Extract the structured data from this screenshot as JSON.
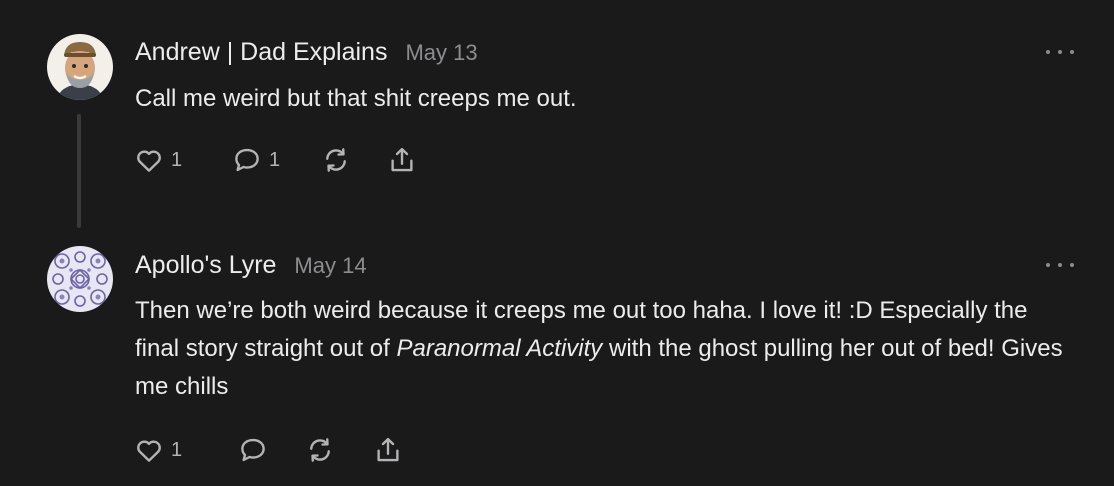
{
  "comments": [
    {
      "author": "Andrew | Dad Explains",
      "date": "May 13",
      "text": "Call me weird but that shit creeps me out.",
      "likes": "1",
      "replies": "1",
      "avatar_icon": "cartoon-man-portrait"
    },
    {
      "author": "Apollo's Lyre",
      "date": "May 14",
      "text_before": "Then we’re both weird because it creeps me out too haha. I love it! :D Especially the final story straight out of ",
      "text_italic": "Paranormal Activity",
      "text_after": " with the ghost pulling her out of bed! Gives me chills",
      "likes": "1",
      "avatar_icon": "purple-pattern-tile"
    }
  ],
  "icons": {
    "like": "heart-icon",
    "reply": "speech-bubble-icon",
    "restack": "restack-arrows-icon",
    "share": "share-icon",
    "more": "more-dots-icon"
  },
  "colors": {
    "background": "#1a1a1b",
    "text": "#ececec",
    "muted": "#8d8d8f",
    "icon": "#b4b4b6",
    "thread_line": "#3a3a3b"
  }
}
